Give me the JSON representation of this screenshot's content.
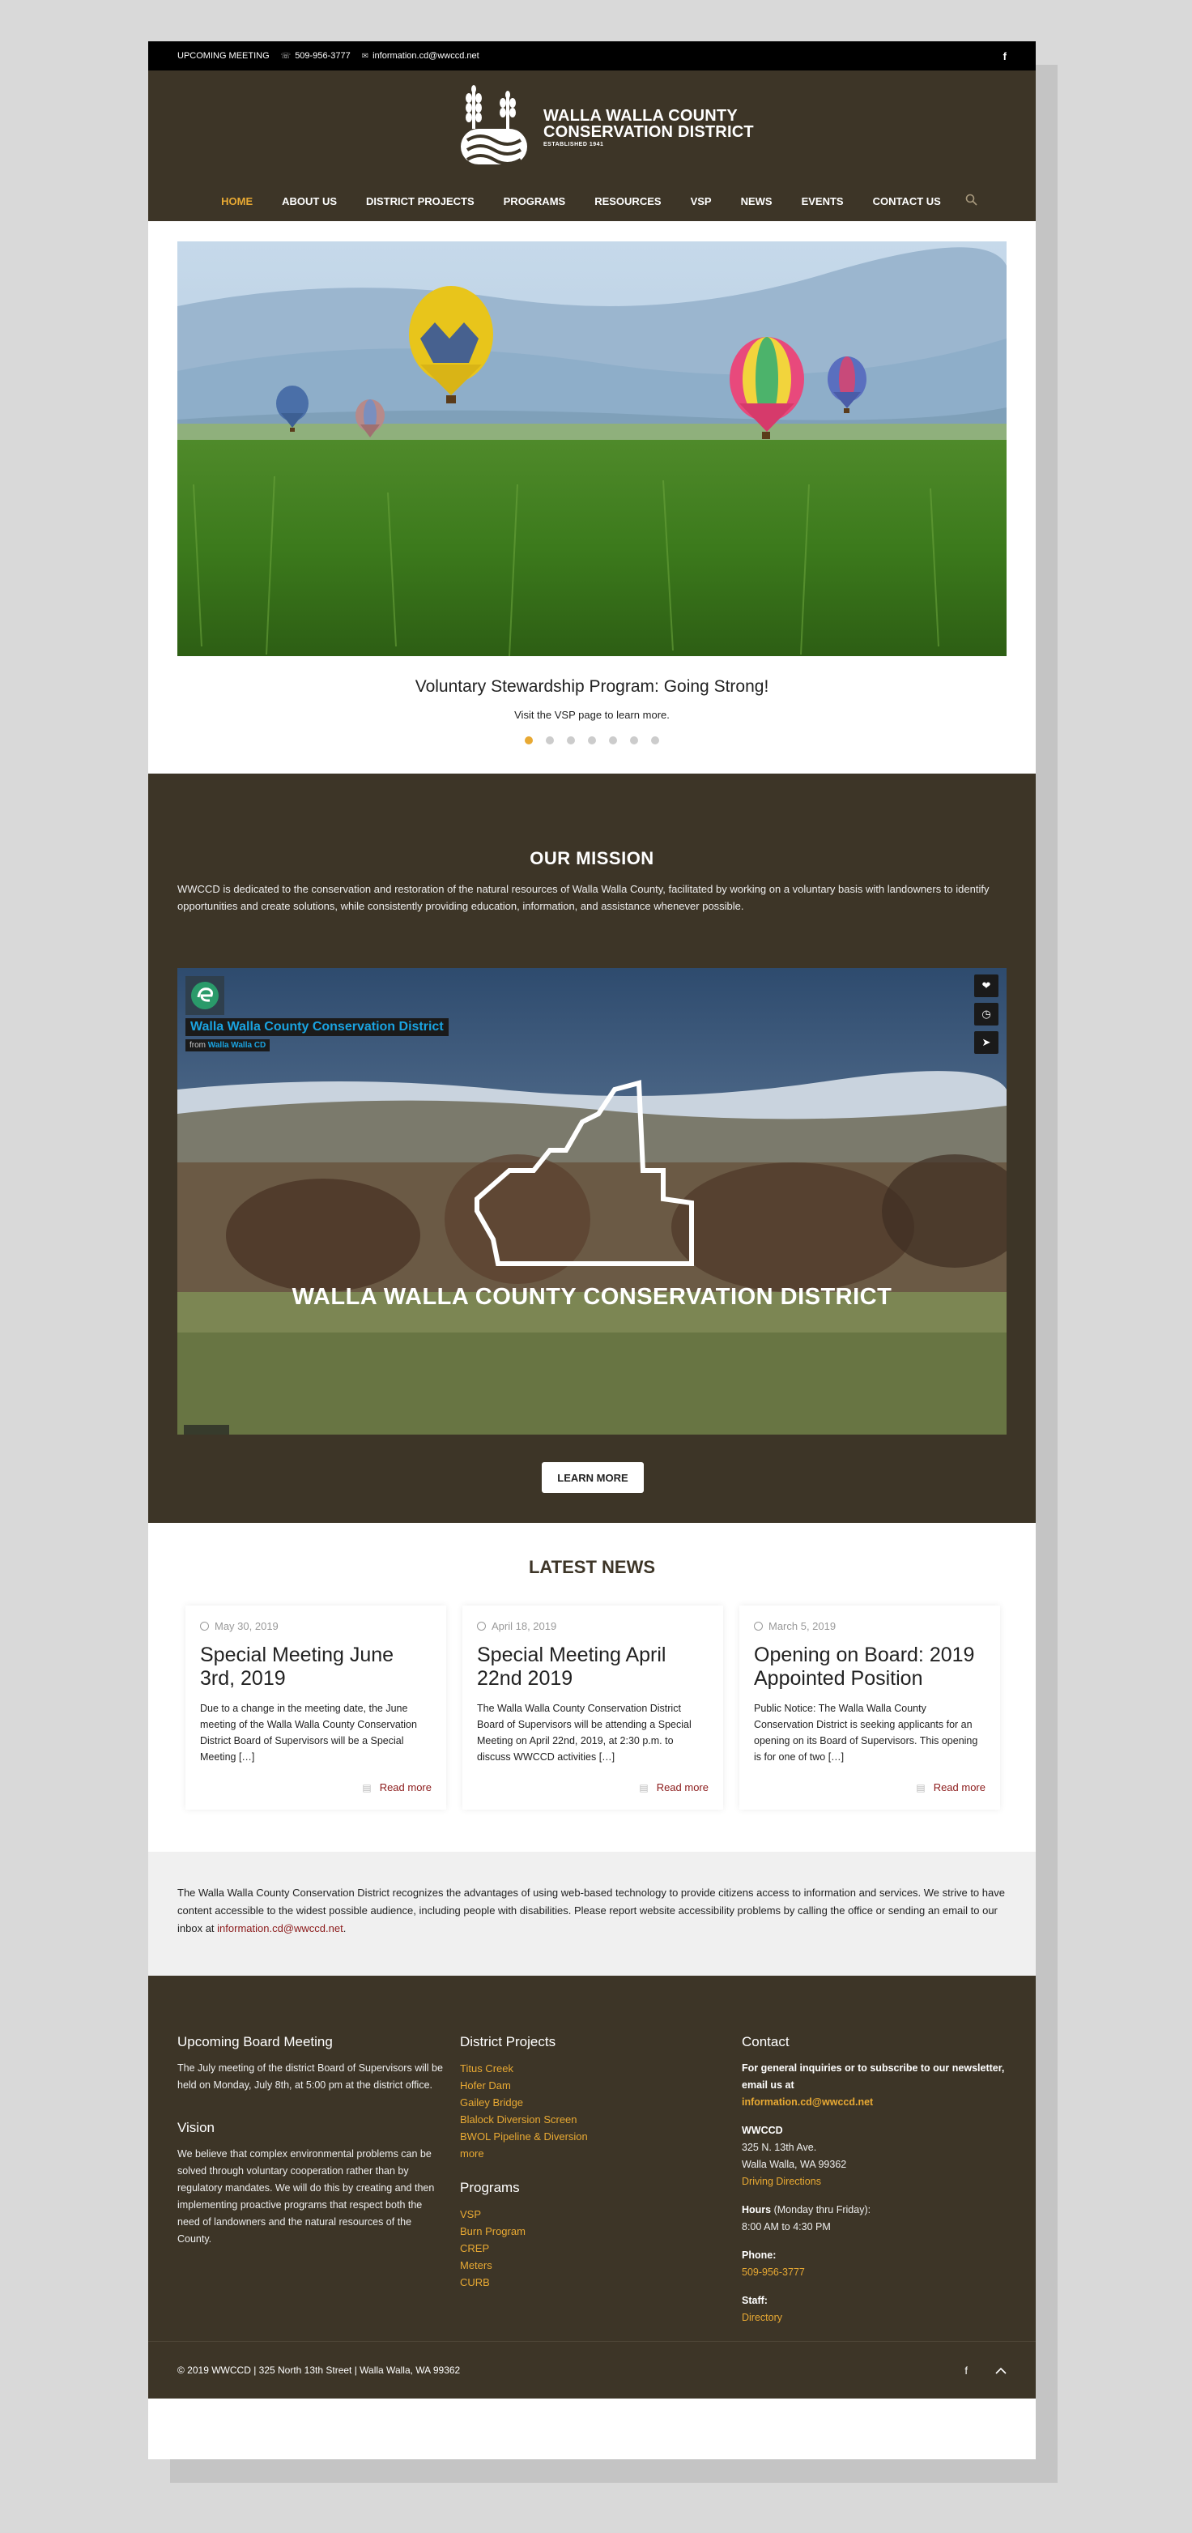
{
  "topbar": {
    "meeting": "UPCOMING MEETING",
    "phone": "509-956-3777",
    "email": "information.cd@wwccd.net",
    "facebook": "f"
  },
  "logo": {
    "line1": "WALLA WALLA COUNTY",
    "line2": "CONSERVATION DISTRICT",
    "line3": "ESTABLISHED 1941"
  },
  "nav": [
    "HOME",
    "ABOUT US",
    "DISTRICT PROJECTS",
    "PROGRAMS",
    "RESOURCES",
    "VSP",
    "NEWS",
    "EVENTS",
    "CONTACT US"
  ],
  "slider": {
    "title": "Voluntary Stewardship Program: Going Strong!",
    "subtitle": "Visit the VSP page to learn more.",
    "dot_count": 7,
    "active_dot": 0
  },
  "mission": {
    "heading": "OUR MISSION",
    "text": "WWCCD is dedicated to the conservation and restoration of the natural resources of Walla Walla County, facilitated by working on a voluntary basis with landowners to identify opportunities and create solutions, while consistently providing education, information, and assistance whenever possible.",
    "video_title": "Walla Walla County Conservation District",
    "video_from_label": "from",
    "video_from": "Walla Walla CD",
    "video_heading": "WALLA WALLA COUNTY CONSERVATION DISTRICT",
    "learn_more": "LEARN MORE"
  },
  "news": {
    "heading": "LATEST NEWS",
    "read_more": "Read more",
    "items": [
      {
        "date": "May 30, 2019",
        "title": "Special Meeting June 3rd, 2019",
        "excerpt": "Due to a change in the meeting date, the June meeting of the Walla Walla County Conservation District Board of Supervisors will be a Special Meeting […]"
      },
      {
        "date": "April 18, 2019",
        "title": "Special Meeting April 22nd 2019",
        "excerpt": "The Walla Walla County Conservation District Board of Supervisors will be attending a Special Meeting on April 22nd, 2019, at 2:30 p.m. to discuss WWCCD activities […]"
      },
      {
        "date": "March 5, 2019",
        "title": "Opening on Board: 2019 Appointed Position",
        "excerpt": "Public Notice: The Walla Walla County Conservation District is seeking applicants for an opening on its Board of Supervisors. This opening is for one of two […]"
      }
    ]
  },
  "accessibility": {
    "text": "The Walla Walla County Conservation District recognizes the advantages of using web-based technology to provide citizens access to information and services. We strive to have content accessible to the widest possible audience, including people with disabilities. Please report website accessibility problems by calling the office or sending an email to our inbox at ",
    "email": "information.cd@wwccd.net",
    "end": "."
  },
  "footer": {
    "board_heading": "Upcoming Board Meeting",
    "board_text": "The July meeting of the district Board of Supervisors will be held on Monday, July 8th, at 5:00 pm at the district office.",
    "vision_heading": "Vision",
    "vision_text": "We believe that complex environmental problems can be solved through voluntary cooperation rather than by regulatory mandates. We will do this by creating and then implementing proactive programs that respect both the need of landowners and the natural resources of the County.",
    "projects_heading": "District Projects",
    "projects": [
      "Titus Creek",
      "Hofer Dam",
      "Gailey Bridge",
      "Blalock Diversion Screen",
      "BWOL Pipeline & Diversion",
      "more"
    ],
    "programs_heading": "Programs",
    "programs": [
      "VSP",
      "Burn Program",
      "CREP",
      "Meters",
      "CURB"
    ],
    "contact_heading": "Contact",
    "contact_intro": "For general inquiries or to subscribe to our newsletter, email us at",
    "contact_email": "information.cd@wwccd.net",
    "org": "WWCCD",
    "address1": "325 N. 13th Ave.",
    "address2": "Walla Walla, WA 99362",
    "directions": "Driving Directions",
    "hours_label": "Hours",
    "hours_note": " (Monday thru Friday):",
    "hours": "8:00 AM to 4:30 PM",
    "phone_label": "Phone",
    "phone": "509-956-3777",
    "staff_label": "Staff",
    "staff_link": "Directory",
    "copyright": "© 2019 WWCCD | 325 North 13th Street | Walla Walla, WA 99362",
    "facebook": "f",
    "top_icon": "^"
  },
  "colors": {
    "brown": "#3d3527",
    "accent": "#e8a933",
    "link_red": "#8b1a1a"
  }
}
